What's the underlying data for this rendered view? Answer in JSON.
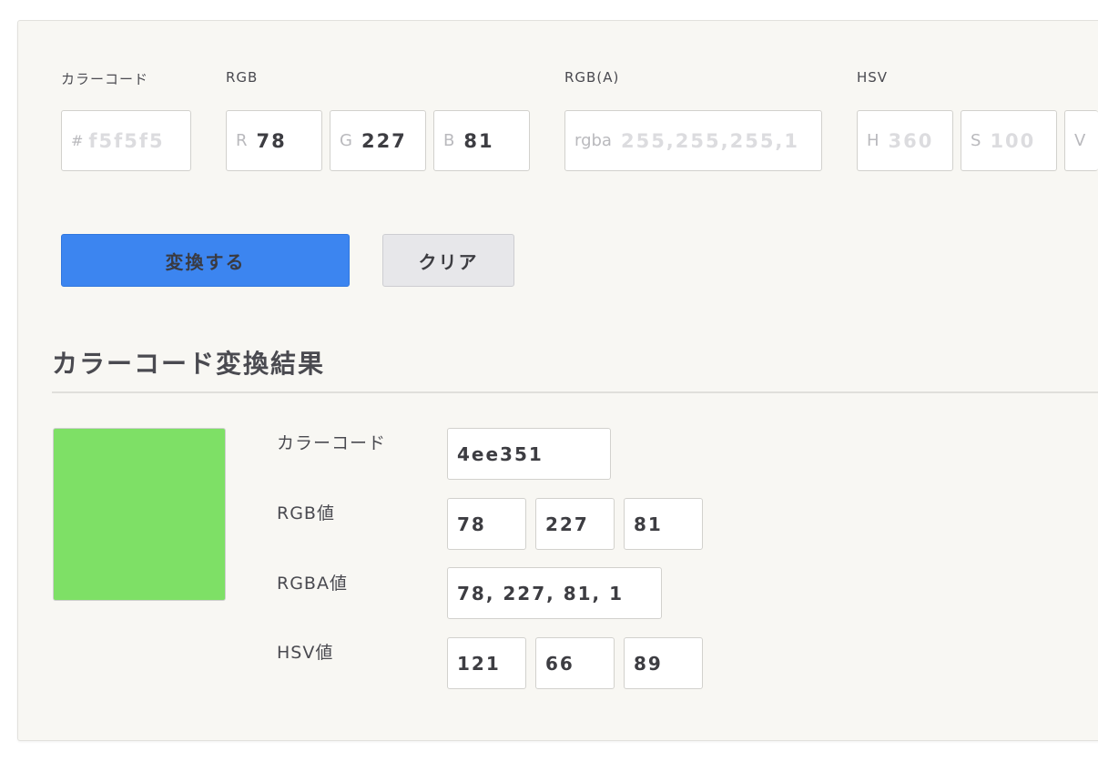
{
  "inputs": {
    "color_code": {
      "label": "カラーコード",
      "prefix": "#",
      "placeholder": "f5f5f5"
    },
    "rgb": {
      "label": "RGB",
      "r": {
        "prefix": "R",
        "value": "78"
      },
      "g": {
        "prefix": "G",
        "value": "227"
      },
      "b": {
        "prefix": "B",
        "value": "81"
      }
    },
    "rgba": {
      "label": "RGB(A)",
      "prefix": "rgba",
      "placeholder": "255,255,255,1"
    },
    "hsv": {
      "label": "HSV",
      "h": {
        "prefix": "H",
        "placeholder": "360"
      },
      "s": {
        "prefix": "S",
        "placeholder": "100"
      },
      "v": {
        "prefix": "V",
        "placeholder": ""
      }
    }
  },
  "buttons": {
    "convert": "変換する",
    "clear": "クリア"
  },
  "result": {
    "title": "カラーコード変換結果",
    "swatch_color": "#7ee066",
    "color_code": {
      "label": "カラーコード",
      "value": "4ee351"
    },
    "rgb": {
      "label": "RGB値",
      "r": "78",
      "g": "227",
      "b": "81"
    },
    "rgba": {
      "label": "RGBA値",
      "value": "78, 227, 81, 1"
    },
    "hsv": {
      "label": "HSV値",
      "h": "121",
      "s": "66",
      "v": "89"
    }
  }
}
